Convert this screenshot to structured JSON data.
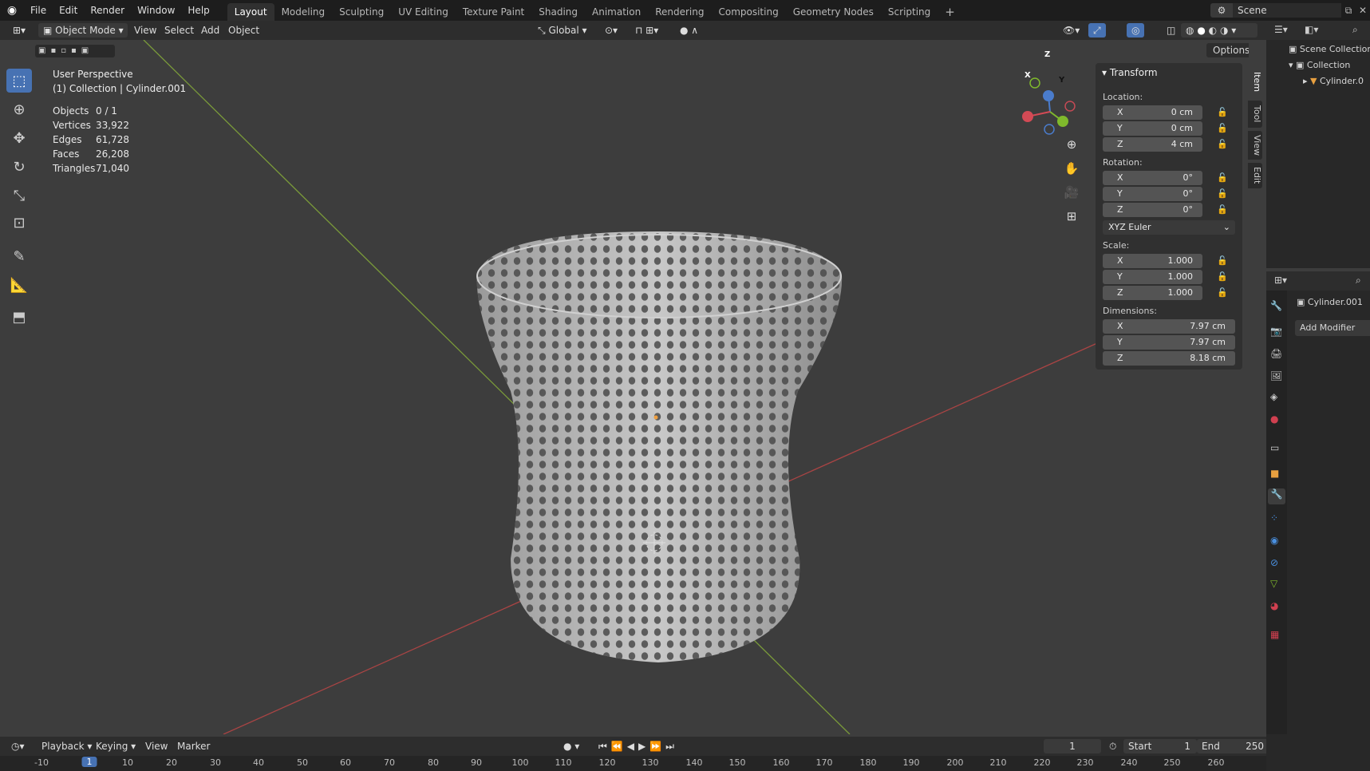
{
  "topmenu": [
    "File",
    "Edit",
    "Render",
    "Window",
    "Help"
  ],
  "workspaces": [
    "Layout",
    "Modeling",
    "Sculpting",
    "UV Editing",
    "Texture Paint",
    "Shading",
    "Animation",
    "Rendering",
    "Compositing",
    "Geometry Nodes",
    "Scripting"
  ],
  "scene_name": "Scene",
  "header": {
    "mode": "Object Mode",
    "menus": [
      "View",
      "Select",
      "Add",
      "Object"
    ],
    "orientation": "Global",
    "options": "Options"
  },
  "viewport": {
    "title": "User Perspective",
    "subtitle": "(1) Collection | Cylinder.001",
    "stats": [
      {
        "label": "Objects",
        "value": "0 / 1"
      },
      {
        "label": "Vertices",
        "value": "33,922"
      },
      {
        "label": "Edges",
        "value": "61,728"
      },
      {
        "label": "Faces",
        "value": "26,208"
      },
      {
        "label": "Triangles",
        "value": "71,040"
      }
    ]
  },
  "transform": {
    "title": "Transform",
    "location_label": "Location:",
    "location": [
      {
        "axis": "X",
        "value": "0 cm"
      },
      {
        "axis": "Y",
        "value": "0 cm"
      },
      {
        "axis": "Z",
        "value": "4 cm"
      }
    ],
    "rotation_label": "Rotation:",
    "rotation": [
      {
        "axis": "X",
        "value": "0°"
      },
      {
        "axis": "Y",
        "value": "0°"
      },
      {
        "axis": "Z",
        "value": "0°"
      }
    ],
    "rotation_mode": "XYZ Euler",
    "scale_label": "Scale:",
    "scale": [
      {
        "axis": "X",
        "value": "1.000"
      },
      {
        "axis": "Y",
        "value": "1.000"
      },
      {
        "axis": "Z",
        "value": "1.000"
      }
    ],
    "dimensions_label": "Dimensions:",
    "dimensions": [
      {
        "axis": "X",
        "value": "7.97 cm"
      },
      {
        "axis": "Y",
        "value": "7.97 cm"
      },
      {
        "axis": "Z",
        "value": "8.18 cm"
      }
    ]
  },
  "sidetabs": [
    "Item",
    "Tool",
    "View",
    "Edit"
  ],
  "gizmo": {
    "x": "X",
    "y": "Y",
    "z": "Z"
  },
  "outliner": {
    "root": "Scene Collection",
    "collection": "Collection",
    "object": "Cylinder.0"
  },
  "properties": {
    "object": "Cylinder.001",
    "add_modifier": "Add Modifier"
  },
  "timeline": {
    "menus": [
      "Playback",
      "Keying",
      "View",
      "Marker"
    ],
    "current_frame": "1",
    "start_label": "Start",
    "start": "1",
    "end_label": "End",
    "end": "250",
    "ruler": [
      "-10",
      "1",
      "10",
      "20",
      "30",
      "40",
      "50",
      "60",
      "70",
      "80",
      "90",
      "100",
      "110",
      "120",
      "130",
      "140",
      "150",
      "160",
      "170",
      "180",
      "190",
      "200",
      "210",
      "220",
      "230",
      "240",
      "250",
      "260"
    ]
  }
}
